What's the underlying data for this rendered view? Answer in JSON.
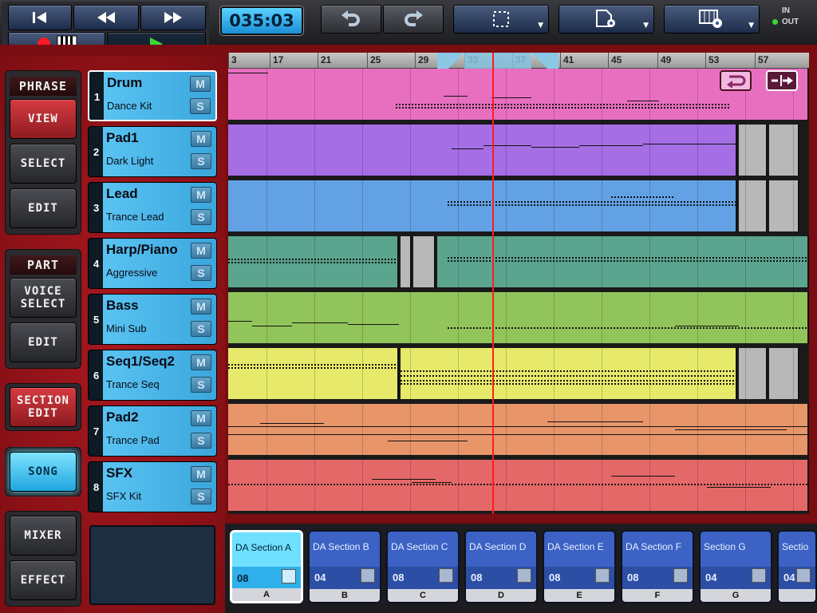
{
  "transport": {
    "rewind_start_icon": "skip-to-start-icon",
    "rewind_icon": "rewind-icon",
    "forward_icon": "fast-forward-icon",
    "record_icon": "record-icon",
    "keyboard_icon": "piano-keyboard-icon",
    "play_icon": "play-icon",
    "time": "035:03"
  },
  "toolbar": {
    "undo_icon": "undo-icon",
    "redo_icon": "redo-icon",
    "select_icon": "dashed-select-icon",
    "file_icon": "file-settings-icon",
    "grid_icon": "grid-settings-icon",
    "in_label": "IN",
    "out_label": "OUT"
  },
  "sidebar": {
    "phrase_label": "PHRASE",
    "view": "VIEW",
    "select": "SELECT",
    "edit": "EDIT",
    "part_label": "PART",
    "voice_select": "VOICE SELECT",
    "part_edit": "EDIT",
    "section_edit": "SECTION EDIT",
    "song": "SONG",
    "mixer": "MIXER",
    "effect": "EFFECT"
  },
  "tracks": [
    {
      "num": "1",
      "name": "Drum",
      "voice": "Dance Kit",
      "color": "#e86fc0"
    },
    {
      "num": "2",
      "name": "Pad1",
      "voice": "Dark Light",
      "color": "#a56ee4"
    },
    {
      "num": "3",
      "name": "Lead",
      "voice": "Trance Lead",
      "color": "#62a2e4"
    },
    {
      "num": "4",
      "name": "Harp/Piano",
      "voice": "Aggressive",
      "color": "#5ba58f"
    },
    {
      "num": "5",
      "name": "Bass",
      "voice": "Mini Sub",
      "color": "#92c45c"
    },
    {
      "num": "6",
      "name": "Seq1/Seq2",
      "voice": "Trance Seq",
      "color": "#e6e96a"
    },
    {
      "num": "7",
      "name": "Pad2",
      "voice": "Trance Pad",
      "color": "#e8956a"
    },
    {
      "num": "8",
      "name": "SFX",
      "voice": "SFX Kit",
      "color": "#e46868"
    }
  ],
  "mute_label": "M",
  "solo_label": "S",
  "ruler": [
    "3",
    "17",
    "21",
    "25",
    "29",
    "33",
    "37",
    "41",
    "45",
    "49",
    "53",
    "57"
  ],
  "sections": [
    {
      "title": "DA Section A",
      "bars": "08",
      "letter": "A"
    },
    {
      "title": "DA Section B",
      "bars": "04",
      "letter": "B"
    },
    {
      "title": "DA Section C",
      "bars": "08",
      "letter": "C"
    },
    {
      "title": "DA Section D",
      "bars": "08",
      "letter": "D"
    },
    {
      "title": "DA Section E",
      "bars": "08",
      "letter": "E"
    },
    {
      "title": "DA Section F",
      "bars": "08",
      "letter": "F"
    },
    {
      "title": "Section G",
      "bars": "04",
      "letter": "G"
    },
    {
      "title": "Sectio",
      "bars": "04",
      "letter": ""
    }
  ]
}
